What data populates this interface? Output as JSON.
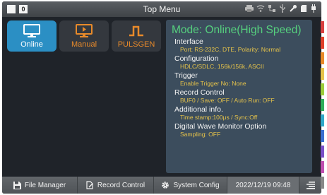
{
  "topbar": {
    "badge": "0",
    "title": "Top Menu"
  },
  "modes": [
    {
      "label": "Online",
      "icon": "monitor-icon",
      "active": true
    },
    {
      "label": "Manual",
      "icon": "monitor-play-icon",
      "active": false
    },
    {
      "label": "PULSGEN",
      "icon": "pulse-wave-icon",
      "active": false
    }
  ],
  "panel": {
    "mode_title": "Mode: Online(High Speed)",
    "sections": [
      {
        "heading": "Interface",
        "value": "Port: RS-232C, DTE, Polarity: Normal"
      },
      {
        "heading": "Configuration",
        "value": "HDLC/SDLC, 156k/156k, ASCII"
      },
      {
        "heading": "Trigger",
        "value": "Enable Trigger No: None"
      },
      {
        "heading": "Record Control",
        "value": "BUF0 / Save: OFF / Auto Run: OFF"
      },
      {
        "heading": "Additional info.",
        "value": "Time stamp:100μs / Sync:Off"
      },
      {
        "heading": "Digital Wave Monitor Option",
        "value": "Sampling: OFF"
      }
    ]
  },
  "bottombar": {
    "file_manager": "File Manager",
    "record_control": "Record Control",
    "system_config": "System Config",
    "datetime": "2022/12/19 09:48"
  },
  "colors": {
    "accent": "#2b8fc4",
    "mode_title": "#56d07e",
    "value_text": "#e6c34a",
    "inactive_label": "#e88a2a",
    "strip": [
      "#d94040",
      "#e0402a",
      "#e88a2a",
      "#e6c34a",
      "#9ccc3a",
      "#2fae5a",
      "#2fa8c8",
      "#3a6fd0",
      "#7a4fc8",
      "#c04fb0",
      "#888888"
    ]
  }
}
